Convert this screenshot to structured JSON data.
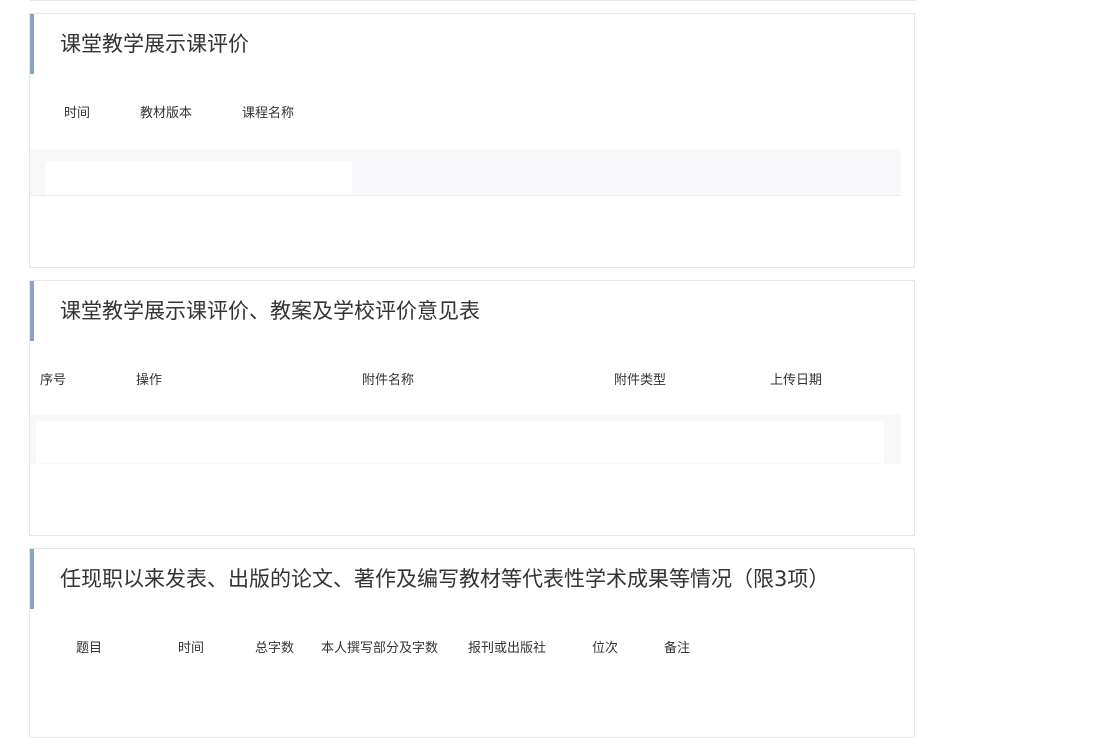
{
  "sections": [
    {
      "title": "课堂教学展示课评价",
      "columns": [
        "时间",
        "教材版本",
        "课程名称"
      ]
    },
    {
      "title": "课堂教学展示课评价、教案及学校评价意见表",
      "columns": [
        "序号",
        "操作",
        "附件名称",
        "附件类型",
        "上传日期"
      ]
    },
    {
      "title": "任现职以来发表、出版的论文、著作及编写教材等代表性学术成果等情况（限3项）",
      "columns": [
        "题目",
        "时间",
        "总字数",
        "本人撰写部分及字数",
        "报刊或出版社",
        "位次",
        "备注"
      ]
    }
  ]
}
